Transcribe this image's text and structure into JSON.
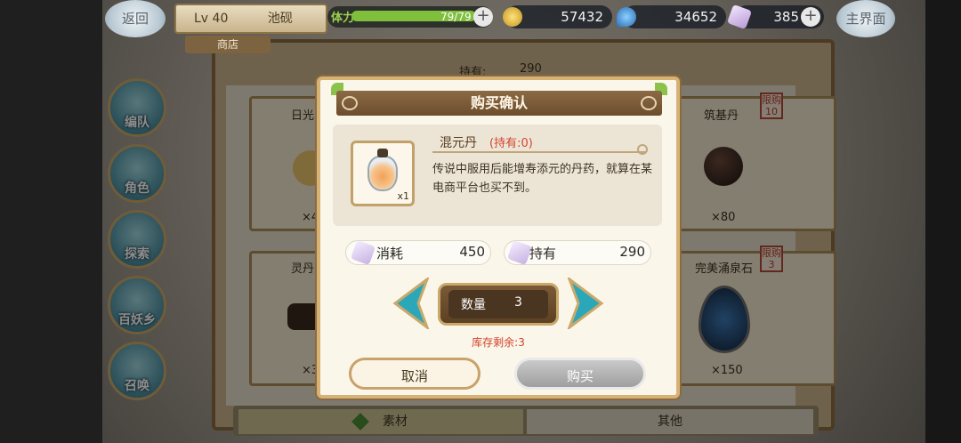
{
  "header": {
    "back_label": "返回",
    "level": "Lv 40",
    "player_name": "池砚",
    "tab_shop": "商店",
    "stamina_label": "体力",
    "stamina_value": "79/79",
    "gold": "57432",
    "spirit": "34652",
    "gems": "385",
    "home_label": "主界面"
  },
  "sidebar": {
    "items": [
      {
        "label": "编队"
      },
      {
        "label": "角色"
      },
      {
        "label": "探索"
      },
      {
        "label": "百妖乡"
      },
      {
        "label": "召唤"
      }
    ]
  },
  "shop": {
    "owned_header": "持有:",
    "owned_value": "290",
    "cards": [
      {
        "name": "日光",
        "price": "×4"
      },
      {
        "name": "筑基丹",
        "price": "×80",
        "limit_label": "限购",
        "limit_value": "10"
      },
      {
        "name": "灵丹",
        "price": "×3"
      },
      {
        "name": "完美涌泉石",
        "price": "×150",
        "limit_label": "限购",
        "limit_value": "3"
      }
    ],
    "bottom_tabs": [
      {
        "label": "素材"
      },
      {
        "label": "其他"
      }
    ]
  },
  "dialog": {
    "title": "购买确认",
    "item_name": "混元丹",
    "item_owned": "(持有:0)",
    "item_count": "x1",
    "item_desc": "传说中服用后能增寿添元的丹药，就算在某电商平台也买不到。",
    "cost_label": "消耗",
    "cost_value": "450",
    "have_label": "持有",
    "have_value": "290",
    "qty_label": "数量",
    "qty_value": "3",
    "stock_text": "库存剩余:3",
    "cancel_label": "取消",
    "buy_label": "购买"
  },
  "colors": {
    "accent_brown": "#6b4e2e",
    "warning_red": "#d0452c",
    "teal_arrow": "#2aa7b8"
  }
}
